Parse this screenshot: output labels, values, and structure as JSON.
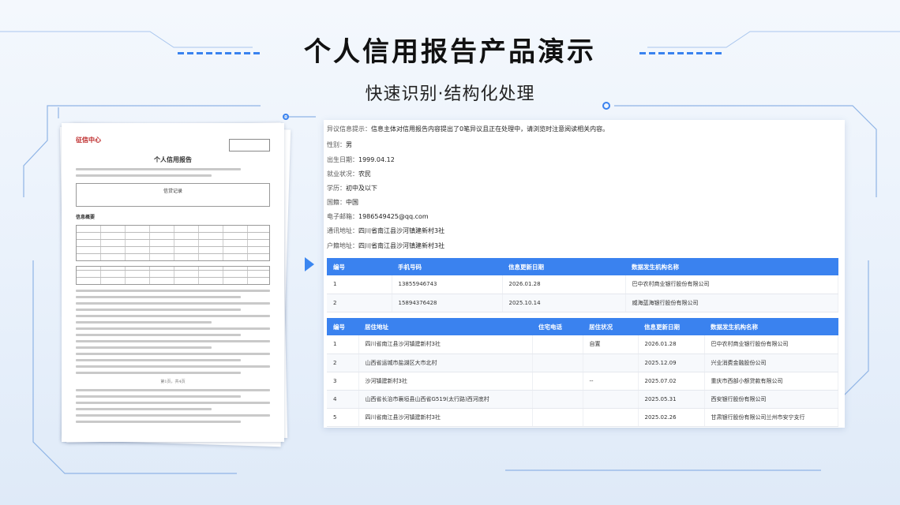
{
  "header": {
    "title": "个人信用报告产品演示",
    "subtitle": "快速识别·结构化处理"
  },
  "document": {
    "logo": "征信中心",
    "title": "个人信用报告",
    "section": "信贷记录",
    "summary": "信息概要",
    "page": "第1页，共4页"
  },
  "info": {
    "dispute_label": "异议信息提示：",
    "dispute_value": "信息主体对信用报告内容提出了0笔异议且正在处理中，请浏览时注意阅读相关内容。",
    "gender_label": "性别：",
    "gender_value": "男",
    "birth_label": "出生日期：",
    "birth_value": "1999.04.12",
    "employment_label": "就业状况：",
    "employment_value": "农民",
    "education_label": "学历：",
    "education_value": "初中及以下",
    "nationality_label": "国籍：",
    "nationality_value": "中国",
    "email_label": "电子邮箱：",
    "email_value": "1986549425@qq.com",
    "address_label": "通讯地址：",
    "address_value": "四川省南江县沙河镇建新村3社",
    "hukou_label": "户籍地址：",
    "hukou_value": "四川省南江县沙河镇建新村3社"
  },
  "phone_table": {
    "headers": [
      "编号",
      "手机号码",
      "信息更新日期",
      "数据发生机构名称"
    ],
    "rows": [
      [
        "1",
        "13855946743",
        "2026.01.28",
        "巴中农村商业银行股份有限公司"
      ],
      [
        "2",
        "15894376428",
        "2025.10.14",
        "威海蓝海银行股份有限公司"
      ]
    ]
  },
  "address_table": {
    "headers": [
      "编号",
      "居住地址",
      "住宅电话",
      "居住状况",
      "信息更新日期",
      "数据发生机构名称"
    ],
    "rows": [
      [
        "1",
        "四川省南江县沙河镇建新村3社",
        "",
        "自置",
        "2026.01.28",
        "巴中农村商业银行股份有限公司"
      ],
      [
        "2",
        "山西省运城市盐湖区大市北村",
        "",
        "",
        "2025.12.09",
        "兴业消费金融股份公司"
      ],
      [
        "3",
        "沙河镇建新村3社",
        "",
        "--",
        "2025.07.02",
        "重庆市西部小额贷款有限公司"
      ],
      [
        "4",
        "山西省长治市襄垣县山西省G519(太行路)西河底村",
        "",
        "",
        "2025.05.31",
        "西安银行股份有限公司"
      ],
      [
        "5",
        "四川省南江县沙河镇建新村3社",
        "",
        "",
        "2025.02.26",
        "甘肃银行股份有限公司兰州市安宁支行"
      ]
    ]
  }
}
